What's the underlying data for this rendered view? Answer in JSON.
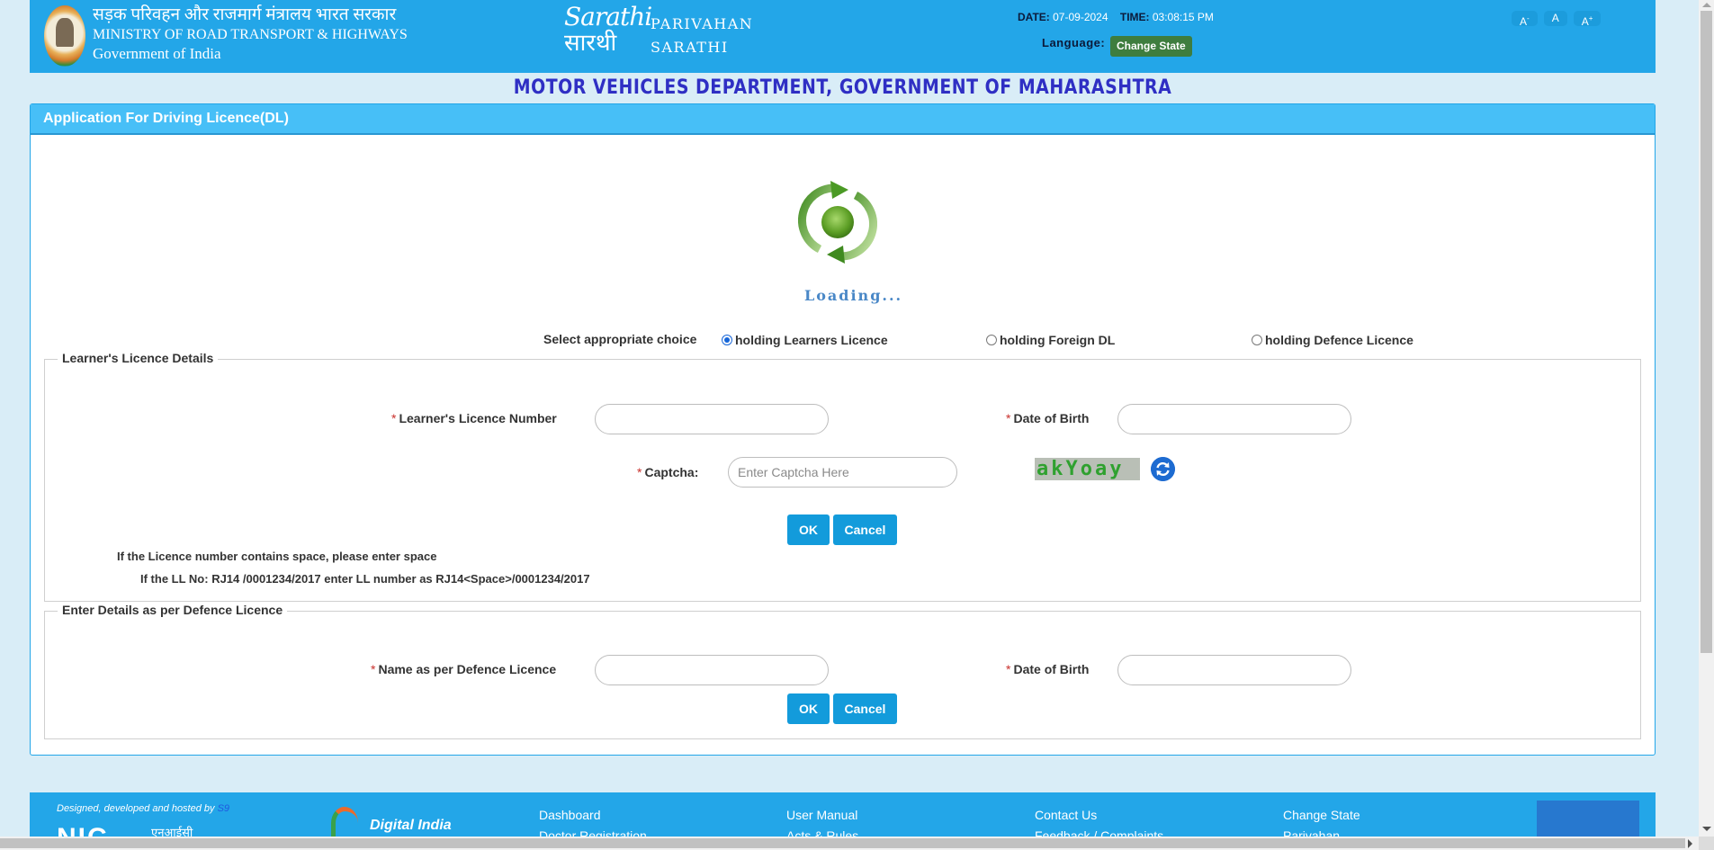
{
  "header": {
    "ministry_hindi": "सड़क परिवहन और राजमार्ग मंत्रालय भारत सरकार",
    "ministry_english": "MINISTRY OF ROAD TRANSPORT & HIGHWAYS",
    "government": "Government of India",
    "logo_text_top": "Sarathi",
    "logo_text_bottom": "सारथी",
    "brand_line1": "PARIVAHAN",
    "brand_line2": "SARATHI",
    "date_label": "DATE:",
    "date_value": "07-09-2024",
    "time_label": "TIME:",
    "time_value": "03:08:15 PM",
    "language_label": "Language:",
    "change_state_label": "Change State",
    "font_decrease": "A",
    "font_decrease_sup": "-",
    "font_normal": "A",
    "font_increase": "A",
    "font_increase_sup": "+"
  },
  "department_title": "MOTOR VEHICLES DEPARTMENT, GOVERNMENT OF MAHARASHTRA",
  "panel": {
    "heading": "Application For Driving Licence(DL)",
    "loading_text": "Loading...",
    "choice_label": "Select appropriate choice",
    "choices": [
      {
        "label": "holding Learners Licence",
        "selected": true
      },
      {
        "label": "holding Foreign DL",
        "selected": false
      },
      {
        "label": "holding Defence Licence",
        "selected": false
      }
    ]
  },
  "learner_section": {
    "legend": "Learner's Licence Details",
    "required_mark": "*",
    "ll_number_label": "Learner's Licence Number",
    "ll_number_value": "",
    "dob_label": "Date of Birth",
    "dob_value": "",
    "captcha_label": "Captcha:",
    "captcha_placeholder": "Enter Captcha Here",
    "captcha_image_text": "akYoay",
    "ok_label": "OK",
    "cancel_label": "Cancel",
    "note1": "If the Licence number contains space, please enter space",
    "note2": "If the LL No: RJ14 /0001234/2017 enter LL number as RJ14<Space>/0001234/2017"
  },
  "defence_section": {
    "legend": "Enter Details as per Defence Licence",
    "required_mark": "*",
    "name_label": "Name as per Defence Licence",
    "name_value": "",
    "dob_label": "Date of Birth",
    "dob_value": "",
    "ok_label": "OK",
    "cancel_label": "Cancel"
  },
  "footer": {
    "designed_by": "Designed, developed and hosted by",
    "designed_by_org": "S9",
    "nic_logo": "NIC",
    "nic_hindi": "एनआईसी",
    "digital_india": "Digital India",
    "links_col1": [
      "Dashboard",
      "Doctor Registration"
    ],
    "links_col2": [
      "User Manual",
      "Acts & Rules"
    ],
    "links_col3": [
      "Contact Us",
      "Feedback / Complaints"
    ],
    "links_col4": [
      "Change State",
      "Parivahan"
    ]
  },
  "colors": {
    "header_bg": "#23a6e8",
    "page_bg": "#d9edf7",
    "panel_heading_bg": "#47bff7",
    "dept_title": "#2f2fc4",
    "button_bg": "#139bdb",
    "change_state_bg": "#3e7d3e",
    "required": "#c9302c"
  }
}
